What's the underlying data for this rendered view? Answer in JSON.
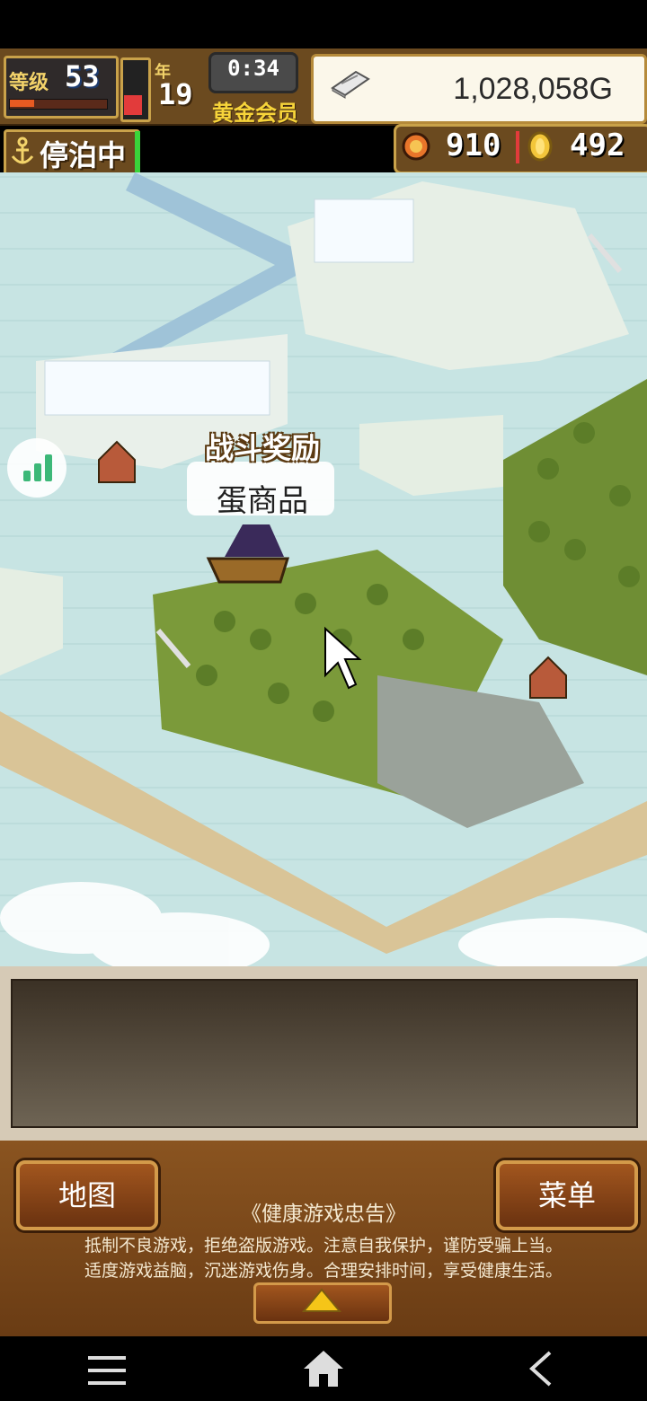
{
  "hud": {
    "level_label": "等级",
    "level": "53",
    "year_label": "年",
    "year": "19",
    "time": "0:34",
    "member": "黄金会员",
    "money": "1,028,058G"
  },
  "status": {
    "anchor_label": "停泊中",
    "resource1": "910",
    "resource2": "492"
  },
  "map": {
    "bubble_title": "战斗奖励",
    "bubble_text": "蛋商品"
  },
  "bottom": {
    "map_button": "地图",
    "menu_button": "菜单",
    "notice_title": "《健康游戏忠告》",
    "notice_line1": "抵制不良游戏，拒绝盗版游戏。注意自我保护，谨防受骗上当。",
    "notice_line2": "适度游戏益脑，沉迷游戏伤身。合理安排时间，享受健康生活。"
  },
  "colors": {
    "wood": "#6b4a1f",
    "gold_border": "#c9a24a",
    "sea": "#c7e4e3"
  },
  "progress": {
    "exp_fraction": 0.25,
    "hp_fraction": 0.35
  }
}
